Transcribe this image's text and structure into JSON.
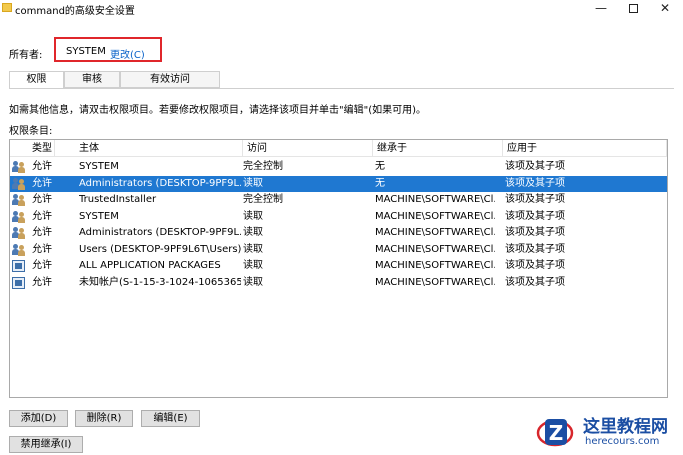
{
  "window": {
    "title": "command的高级安全设置",
    "min_glyph": "—",
    "close_glyph": "✕"
  },
  "owner": {
    "label": "所有者:",
    "name": "SYSTEM",
    "change_link": "更改(C)"
  },
  "tabs": [
    {
      "label": "权限",
      "active": true
    },
    {
      "label": "审核",
      "active": false
    },
    {
      "label": "有效访问",
      "active": false
    }
  ],
  "info_text": "如需其他信息，请双击权限项目。若要修改权限项目，请选择该项目并单击\"编辑\"(如果可用)。",
  "entries_label": "权限条目:",
  "columns": {
    "type": "类型",
    "principal": "主体",
    "access": "访问",
    "inherited_from": "继承于",
    "applies_to": "应用于"
  },
  "rows": [
    {
      "icon": "users-icon",
      "type": "允许",
      "principal": "SYSTEM",
      "access": "完全控制",
      "inherited_from": "无",
      "applies_to": "该项及其子项",
      "selected": false
    },
    {
      "icon": "users-icon",
      "type": "允许",
      "principal": "Administrators (DESKTOP-9PF9L...",
      "access": "读取",
      "inherited_from": "无",
      "applies_to": "该项及其子项",
      "selected": true
    },
    {
      "icon": "users-icon",
      "type": "允许",
      "principal": "TrustedInstaller",
      "access": "完全控制",
      "inherited_from": "MACHINE\\SOFTWARE\\Cl...",
      "applies_to": "该项及其子项",
      "selected": false
    },
    {
      "icon": "users-icon",
      "type": "允许",
      "principal": "SYSTEM",
      "access": "读取",
      "inherited_from": "MACHINE\\SOFTWARE\\Cl...",
      "applies_to": "该项及其子项",
      "selected": false
    },
    {
      "icon": "users-icon",
      "type": "允许",
      "principal": "Administrators (DESKTOP-9PF9L...",
      "access": "读取",
      "inherited_from": "MACHINE\\SOFTWARE\\Cl...",
      "applies_to": "该项及其子项",
      "selected": false
    },
    {
      "icon": "users-icon",
      "type": "允许",
      "principal": "Users (DESKTOP-9PF9L6T\\Users)",
      "access": "读取",
      "inherited_from": "MACHINE\\SOFTWARE\\Cl...",
      "applies_to": "该项及其子项",
      "selected": false
    },
    {
      "icon": "package-icon",
      "type": "允许",
      "principal": "ALL APPLICATION PACKAGES",
      "access": "读取",
      "inherited_from": "MACHINE\\SOFTWARE\\Cl...",
      "applies_to": "该项及其子项",
      "selected": false
    },
    {
      "icon": "package-icon",
      "type": "允许",
      "principal": "未知帐户(S-1-15-3-1024-1065365...",
      "access": "读取",
      "inherited_from": "MACHINE\\SOFTWARE\\Cl...",
      "applies_to": "该项及其子项",
      "selected": false
    }
  ],
  "buttons": {
    "add": "添加(D)",
    "remove": "删除(R)",
    "edit": "编辑(E)",
    "disable_inheritance": "禁用继承(I)"
  },
  "watermark": {
    "title": "这里教程网",
    "url": "herecours.com",
    "logo_letter": "Z"
  },
  "colors": {
    "selection": "#1f78d1",
    "link": "#0b63c9",
    "highlight_box": "#e0262b",
    "watermark": "#1b4ea3"
  }
}
